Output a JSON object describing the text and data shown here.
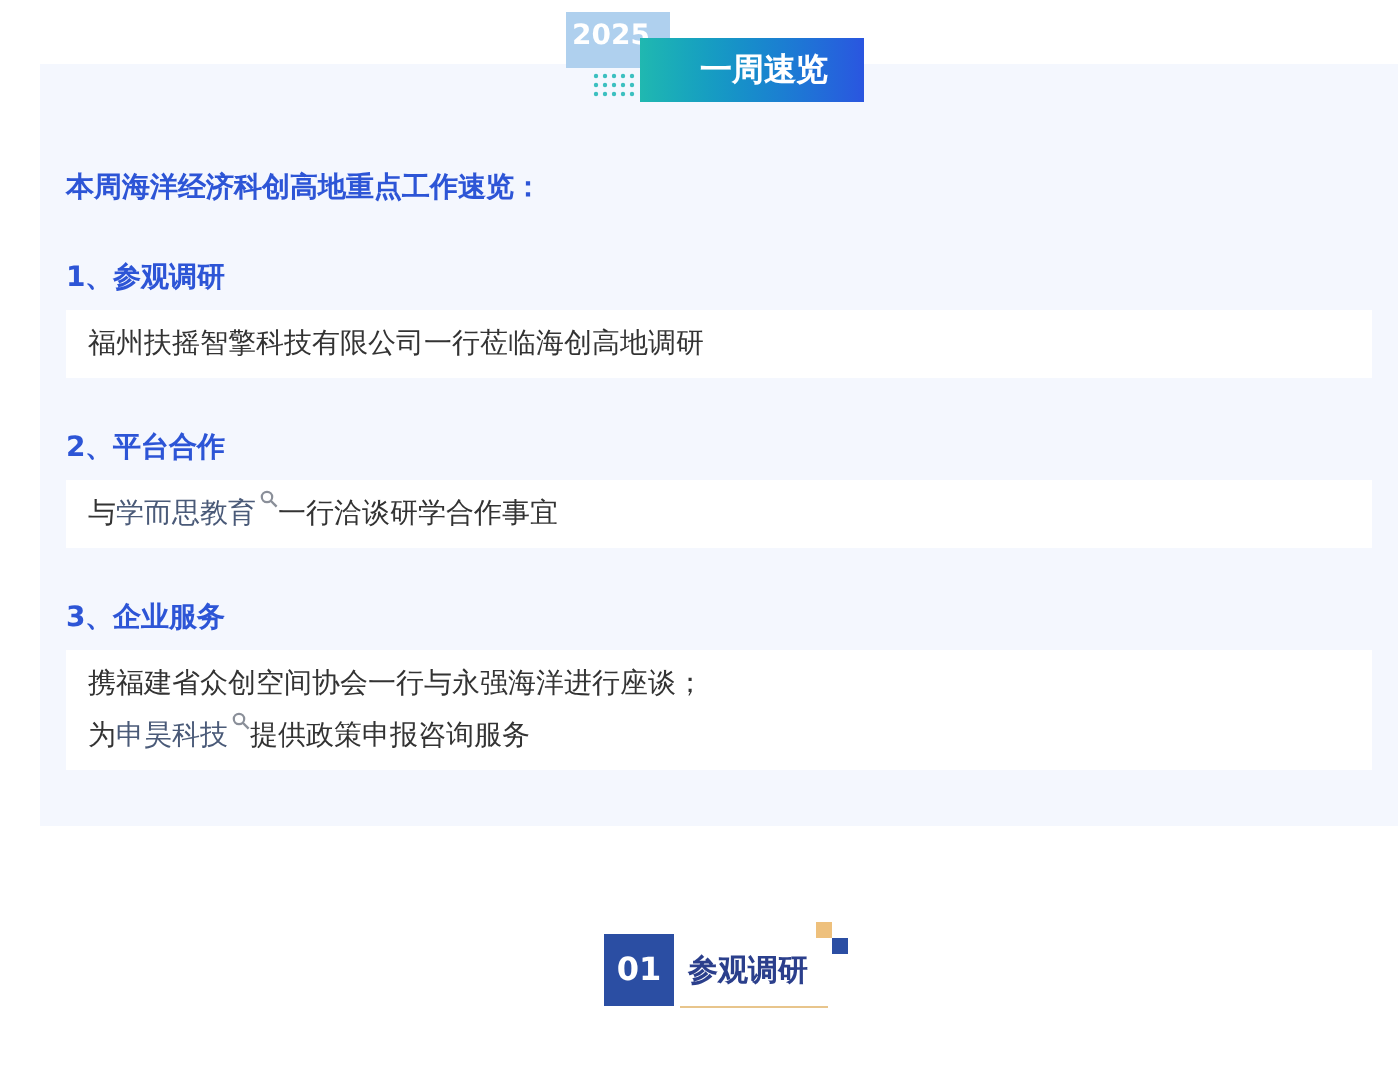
{
  "header": {
    "year": "2025",
    "title": "一周速览"
  },
  "intro": "本周海洋经济科创高地重点工作速览：",
  "sections": [
    {
      "heading": "1、参观调研",
      "lines": [
        [
          {
            "kind": "plain",
            "text": "福州扶摇智擎科技有限公司一行莅临海创高地调研"
          }
        ]
      ]
    },
    {
      "heading": "2、平台合作",
      "lines": [
        [
          {
            "kind": "plain",
            "text": "与"
          },
          {
            "kind": "link",
            "text": "学而思教育"
          },
          {
            "kind": "plain",
            "text": "一行洽谈研学合作事宜"
          }
        ]
      ]
    },
    {
      "heading": "3、企业服务",
      "lines": [
        [
          {
            "kind": "plain",
            "text": "携福建省众创空间协会一行与永强海洋进行座谈；"
          }
        ],
        [
          {
            "kind": "plain",
            "text": "为"
          },
          {
            "kind": "link",
            "text": "申昊科技"
          },
          {
            "kind": "plain",
            "text": "提供政策申报咨询服务"
          }
        ]
      ]
    }
  ],
  "chapter": {
    "number": "01",
    "title": "参观调研"
  }
}
